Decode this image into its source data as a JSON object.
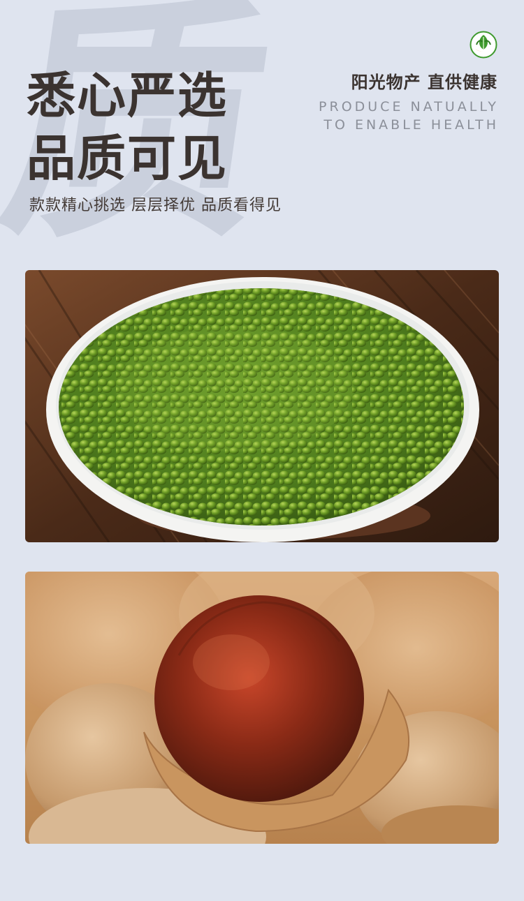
{
  "watermark": "质",
  "headline": {
    "line1": "悉心严选",
    "line2": "品质可见"
  },
  "subline": "款款精心挑选 层层择优 品质看得见",
  "brand": {
    "logo_icon": "leaf-logo-icon",
    "slogan_cn": "阳光物产 直供健康",
    "slogan_en_line1": "PRODUCE NATUALLY",
    "slogan_en_line2": "TO ENABLE HEALTH"
  },
  "colors": {
    "background": "#dfe4ef",
    "headline": "#3b3330",
    "english_slogan": "#8b8f99",
    "logo_green": "#3f9a2e"
  },
  "images": [
    {
      "name": "mung-beans-photo",
      "subject": "mung-beans-bowl"
    },
    {
      "name": "dried-longan-photo",
      "subject": "dried-longan"
    }
  ]
}
